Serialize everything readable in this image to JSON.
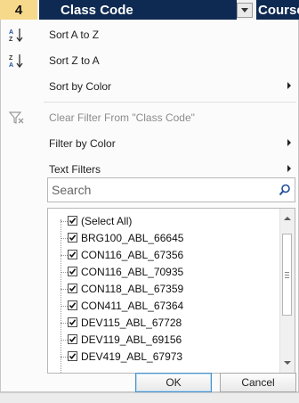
{
  "header": {
    "row_number": "4",
    "column_header": "Class Code",
    "next_column_header": "Course"
  },
  "menu": {
    "sort_a_to_z": "Sort A to Z",
    "sort_z_to_a": "Sort Z to A",
    "sort_by_color": "Sort by Color",
    "clear_filter": "Clear Filter From \"Class Code\"",
    "filter_by_color": "Filter by Color",
    "text_filters": "Text Filters"
  },
  "search": {
    "placeholder": "Search",
    "value": ""
  },
  "filter_list": {
    "items": [
      {
        "label": "(Select All)",
        "checked": true
      },
      {
        "label": "BRG100_ABL_66645",
        "checked": true
      },
      {
        "label": "CON116_ABL_67356",
        "checked": true
      },
      {
        "label": "CON116_ABL_70935",
        "checked": true
      },
      {
        "label": "CON118_ABL_67359",
        "checked": true
      },
      {
        "label": "CON411_ABL_67364",
        "checked": true
      },
      {
        "label": "DEV115_ABL_67728",
        "checked": true
      },
      {
        "label": "DEV119_ABL_69156",
        "checked": true
      },
      {
        "label": "DEV419_ABL_67973",
        "checked": true
      }
    ]
  },
  "buttons": {
    "ok": "OK",
    "cancel": "Cancel"
  },
  "colors": {
    "header_bg": "#0f2a52",
    "row_number_bg": "#f7d98c",
    "ok_border": "#4a90c8"
  }
}
